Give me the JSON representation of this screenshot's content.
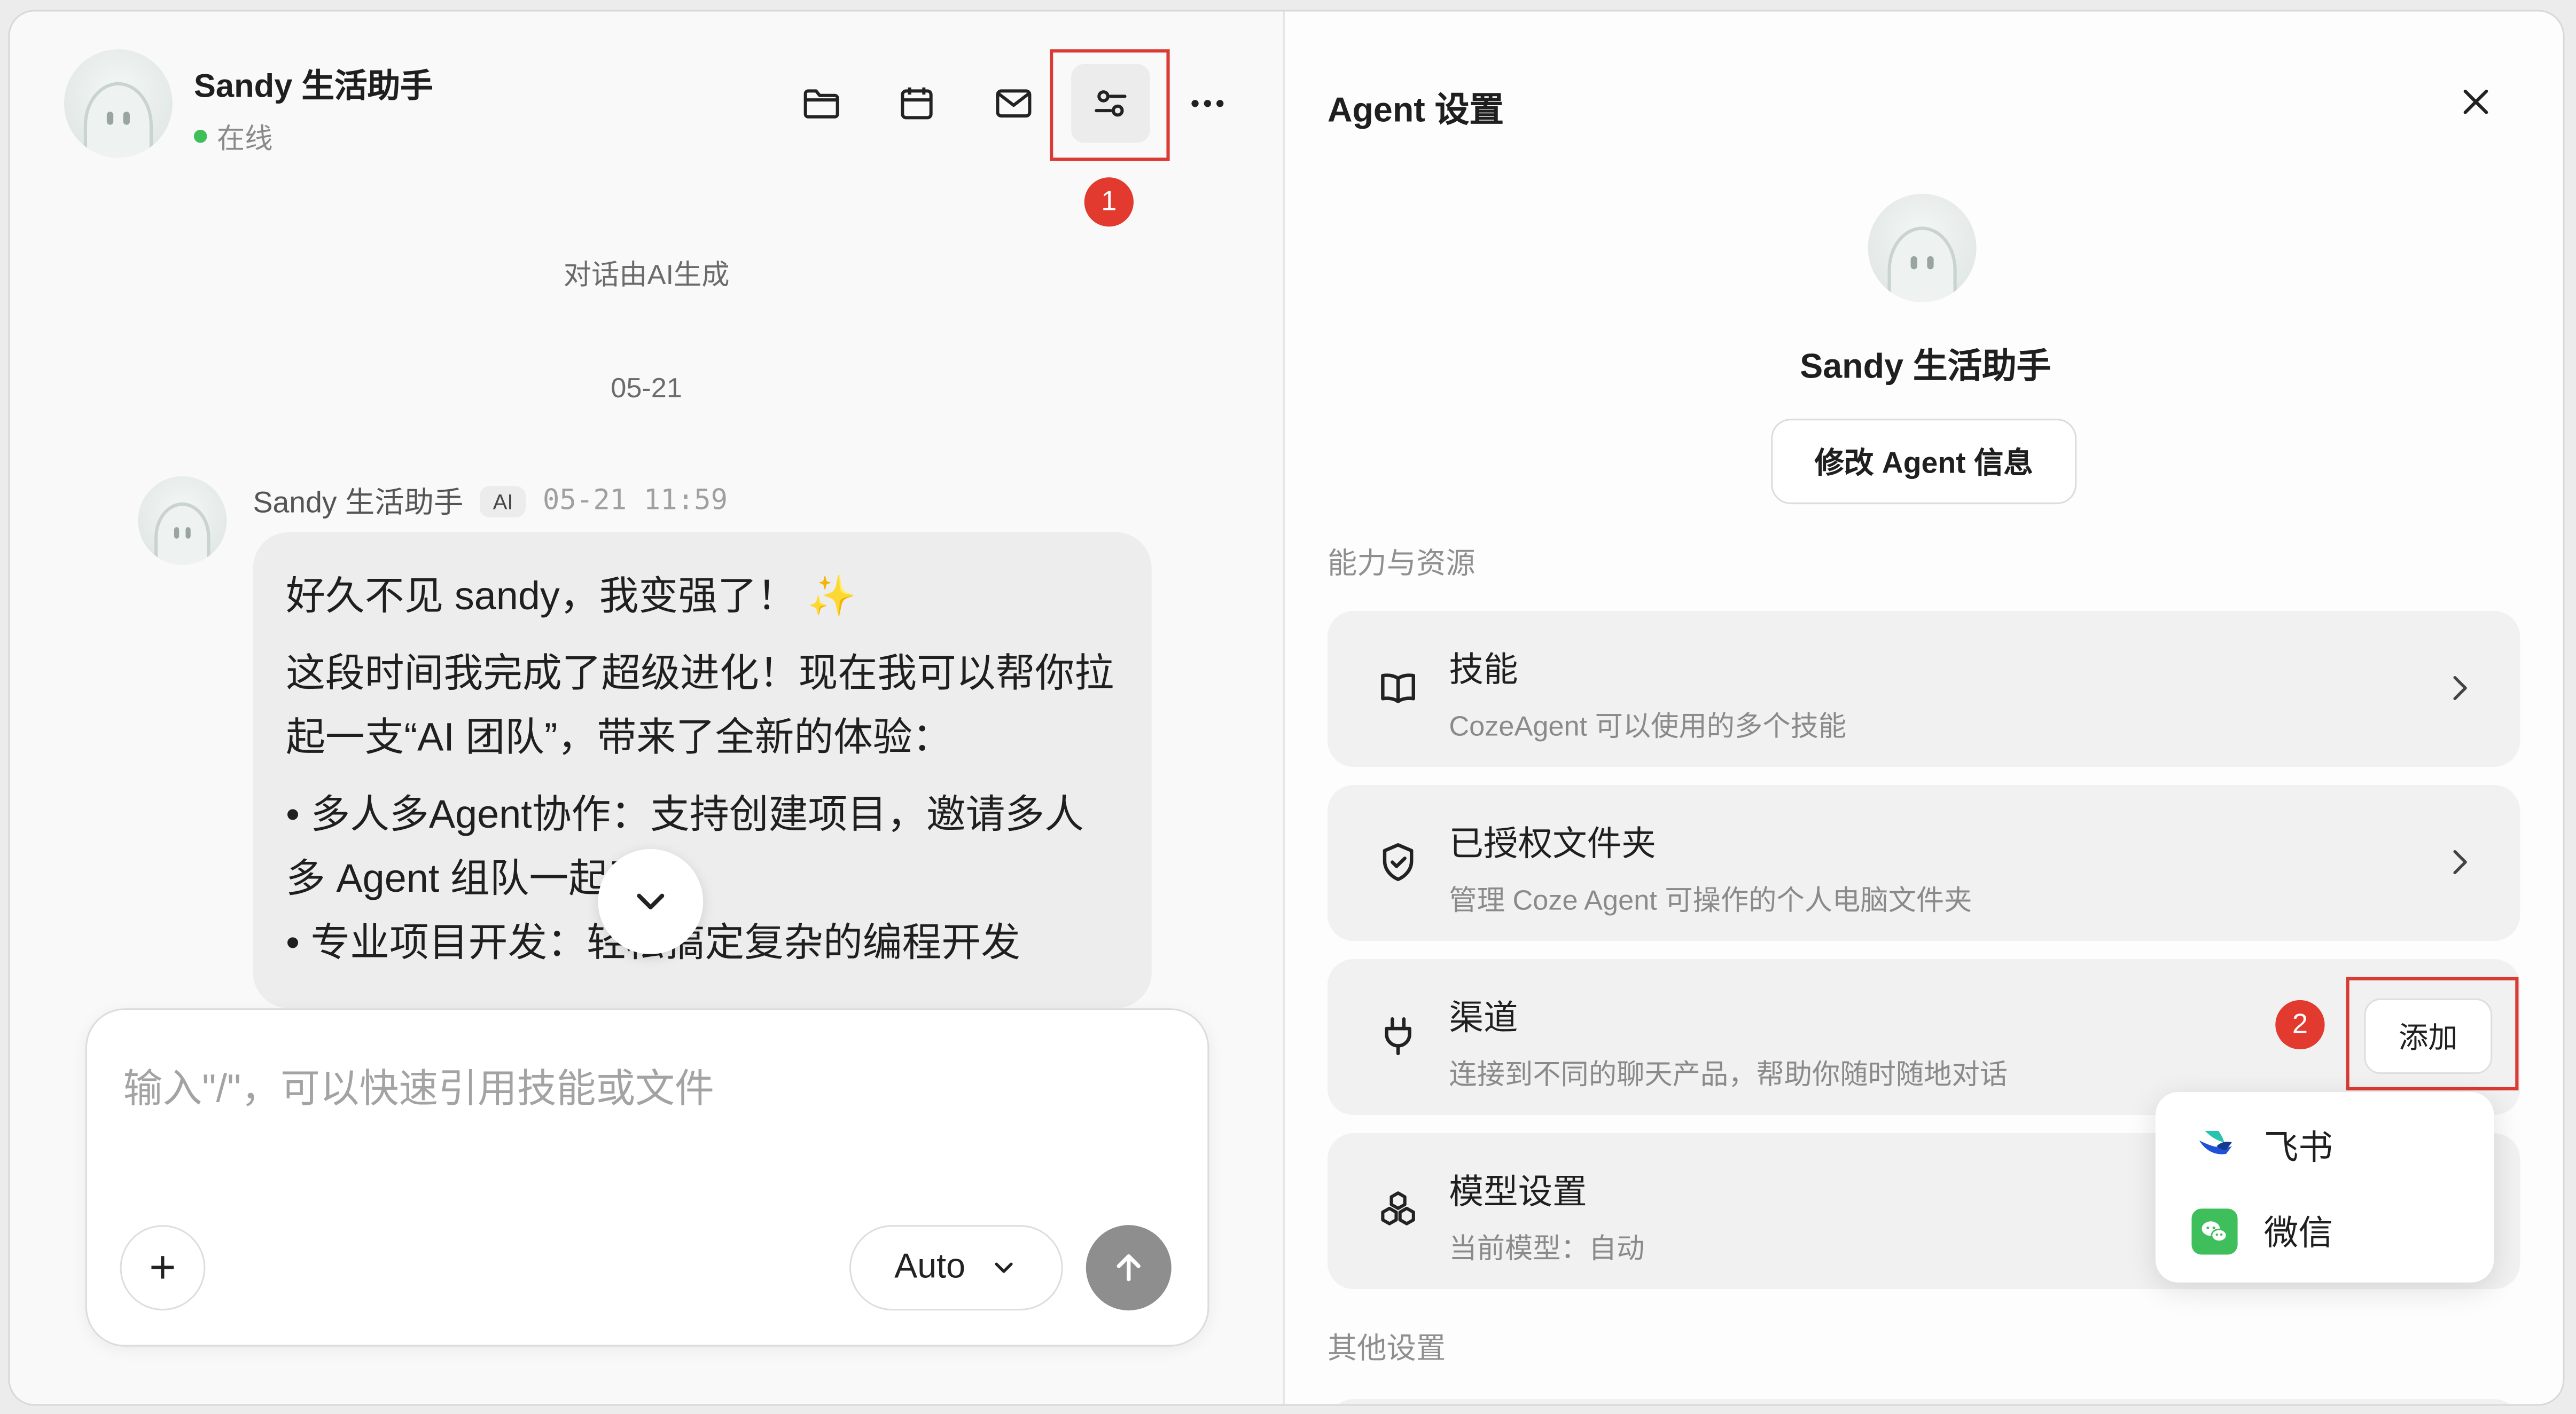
{
  "header": {
    "agent_name": "Sandy 生活助手",
    "status": "在线",
    "icons": [
      "folder-icon",
      "calendar-icon",
      "mail-icon",
      "settings-sliders-icon",
      "more-icon"
    ]
  },
  "annotations": {
    "step1": "1",
    "step2": "2",
    "highlight_color": "#d93a33"
  },
  "chat": {
    "system_note": "对话由AI生成",
    "date_divider": "05-21",
    "message": {
      "sender": "Sandy 生活助手",
      "tag": "AI",
      "time": "05-21 11:59",
      "line1": "好久不见 sandy，我变强了！",
      "sparkle": "✨",
      "line2": "这段时间我完成了超级进化！现在我可以帮你拉起一支“AI 团队”，带来了全新的体验：",
      "bullet1": "• 多人多Agent协作：支持创建项目，邀请多人多 Agent 组队一起干活。",
      "bullet2": "• 专业项目开发：轻松搞定复杂的编程开发"
    }
  },
  "composer": {
    "placeholder": "输入\"/\"，可以快速引用技能或文件",
    "plus_label": "+",
    "model_label": "Auto"
  },
  "settings": {
    "title": "Agent 设置",
    "agent_name": "Sandy 生活助手",
    "edit_button": "修改 Agent 信息",
    "section_resources": "能力与资源",
    "section_other": "其他设置",
    "cards": [
      {
        "title": "技能",
        "subtitle": "CozeAgent 可以使用的多个技能"
      },
      {
        "title": "已授权文件夹",
        "subtitle": "管理 Coze Agent 可操作的个人电脑文件夹"
      },
      {
        "title": "渠道",
        "subtitle": "连接到不同的聊天产品，帮助你随时随地对话"
      },
      {
        "title": "模型设置",
        "subtitle": "当前模型：自动"
      }
    ],
    "add_button": "添加",
    "dropdown": [
      "飞书",
      "微信"
    ]
  }
}
